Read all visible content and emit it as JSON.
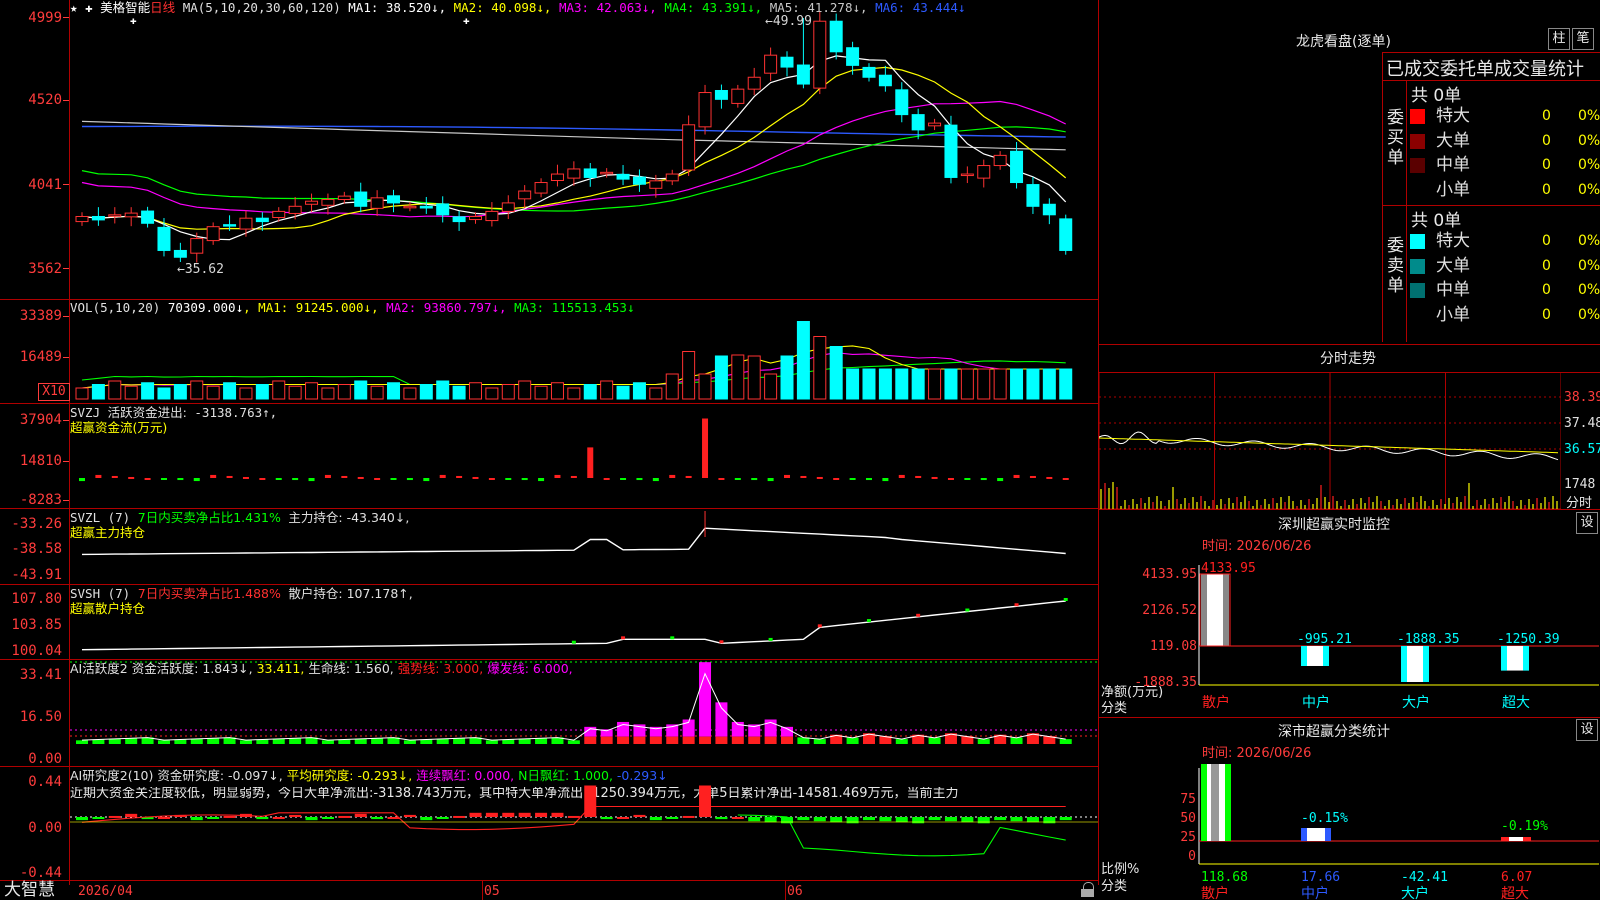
{
  "main": {
    "stock_name": "美格智能",
    "period": "日线",
    "ma_label": "MA(5,10,20,30,60,120)",
    "ma_values": [
      {
        "name": "MA1:",
        "value": "38.520↓",
        "color": "#ffffff"
      },
      {
        "name": "MA2:",
        "value": "40.098↓",
        "color": "#ffff00"
      },
      {
        "name": "MA3:",
        "value": "42.063↓",
        "color": "#ff00ff"
      },
      {
        "name": "MA4:",
        "value": "43.391↓",
        "color": "#00ff00"
      },
      {
        "name": "MA5:",
        "value": "41.278↓",
        "color": "#c8c8c8"
      },
      {
        "name": "MA6:",
        "value": "43.444↓",
        "color": "#2d5aff"
      }
    ],
    "y_labels": [
      "4999",
      "4520",
      "4041",
      "3562"
    ],
    "high_label": "49.99",
    "low_label": "35.62"
  },
  "vol": {
    "header": "VOL(5,10,20)",
    "value": "70309.000↓",
    "ma1": "MA1: 91245.000↓",
    "ma2": "MA2: 93860.797↓",
    "ma3": "MA3: 115513.453↓",
    "y_labels": [
      "33389",
      "16489"
    ],
    "unit": "X10"
  },
  "svzj": {
    "header": "SVZJ",
    "label": "活跃资金进出:",
    "value": "-3138.763↑,",
    "subtitle": "超赢资金流(万元)",
    "y_labels": [
      "37904",
      "14810",
      "-8283"
    ]
  },
  "svzl": {
    "header": "SVZL (7)",
    "label1": "7日内买卖净占比1.431%",
    "label2": "主力持仓: -43.340↓,",
    "subtitle": "超赢主力持仓",
    "y_labels": [
      "-33.26",
      "-38.58",
      "-43.91"
    ]
  },
  "svsh": {
    "header": "SVSH (7)",
    "label1": "7日内买卖净占比1.488%",
    "label2": "散户持仓: 107.178↑,",
    "subtitle": "超赢散户持仓",
    "y_labels": [
      "107.80",
      "103.85",
      "100.04"
    ]
  },
  "ai_active": {
    "header": "AI活跃度2",
    "l1": "资金活跃度: 1.843↓",
    "l2": "33.411,",
    "l3": "生命线: 1.560,",
    "l4": "强势线: 3.000,",
    "l5": "爆发线: 6.000,",
    "y_labels": [
      "33.41",
      "16.50",
      "0.00"
    ]
  },
  "ai_research": {
    "header": "AI研究度2(10)",
    "l1": "资金研究度: -0.097↓,",
    "l2": "平均研究度: -0.293↓,",
    "l3": "连续飘红: 0.000,",
    "l4": "N日飘红: 1.000,",
    "l5": "-0.293↓",
    "comment": "近期大资金关注度较低，明显弱势，今日大单净流出:-3138.743万元，其中特大单净流出:-1250.394万元，大单5日累计净出-14581.469万元，当前主力",
    "y_labels": [
      "0.44",
      "0.00",
      "-0.44"
    ]
  },
  "x_axis": {
    "logo": "大智慧",
    "dates": [
      "2026/04",
      "05",
      "06"
    ]
  },
  "dragon": {
    "title": "龙虎看盘(逐单)",
    "btn1": "柱",
    "btn2": "笔",
    "table_title": "已成交委托单成交量统计",
    "buy_label": "委买单",
    "sell_label": "委卖单",
    "buy_total": "共 0单",
    "sell_total": "共 0单",
    "buy_rows": [
      {
        "label": "特大",
        "count": "0",
        "pct": "0%",
        "color": "#ff0000"
      },
      {
        "label": "大单",
        "count": "0",
        "pct": "0%",
        "color": "#8b0000"
      },
      {
        "label": "中单",
        "count": "0",
        "pct": "0%",
        "color": "#5a0000"
      },
      {
        "label": "小单",
        "count": "0",
        "pct": "0%",
        "color": "#000000"
      }
    ],
    "sell_rows": [
      {
        "label": "特大",
        "count": "0",
        "pct": "0%",
        "color": "#00ffff"
      },
      {
        "label": "大单",
        "count": "0",
        "pct": "0%",
        "color": "#008b8b"
      },
      {
        "label": "中单",
        "count": "0",
        "pct": "0%",
        "color": "#007070"
      },
      {
        "label": "小单",
        "count": "0",
        "pct": "0%",
        "color": "#000000"
      }
    ]
  },
  "intraday": {
    "title": "分时走势",
    "y_labels": [
      "38.39",
      "37.48",
      "36.57"
    ],
    "vol_label": "1748",
    "unit_label": "分时"
  },
  "monitor": {
    "title": "深圳超赢实时监控",
    "set_btn": "设",
    "time": "时间: 2026/06/26",
    "y_labels": [
      "4133.95",
      "2126.52",
      "119.08",
      "-1888.35"
    ],
    "axis_title": "净额(万元)",
    "axis_cat": "分类",
    "categories": [
      "散户",
      "中户",
      "大户",
      "超大"
    ],
    "values": [
      4133.95,
      -995.21,
      -1888.35,
      -1250.39
    ],
    "value_labels": [
      "4133.95",
      "-995.21",
      "-1888.35",
      "-1250.39"
    ]
  },
  "classify": {
    "title": "深市超赢分类统计",
    "set_btn": "设",
    "time": "时间: 2026/06/26",
    "y_labels": [
      "75",
      "50",
      "25",
      "0"
    ],
    "axis_title": "比例%",
    "axis_cat": "分类",
    "categories": [
      "散户",
      "中户",
      "大户",
      "超大"
    ],
    "pct_labels": [
      "",
      "-0.15%",
      "",
      "-0.19%"
    ],
    "bottom_values": [
      "118.68",
      "17.66",
      "-42.41",
      "6.07"
    ]
  },
  "chart_data": {
    "type": "candlestick",
    "title": "美格智能 日线",
    "x": [
      "2026/04",
      "05",
      "06"
    ],
    "ylim": [
      35.0,
      50.5
    ],
    "high": 49.99,
    "low": 35.62,
    "ma_latest": {
      "MA1": 38.52,
      "MA2": 40.098,
      "MA3": 42.063,
      "MA4": 43.391,
      "MA5": 41.278,
      "MA6": 43.444
    },
    "last_volume": 70309.0
  }
}
